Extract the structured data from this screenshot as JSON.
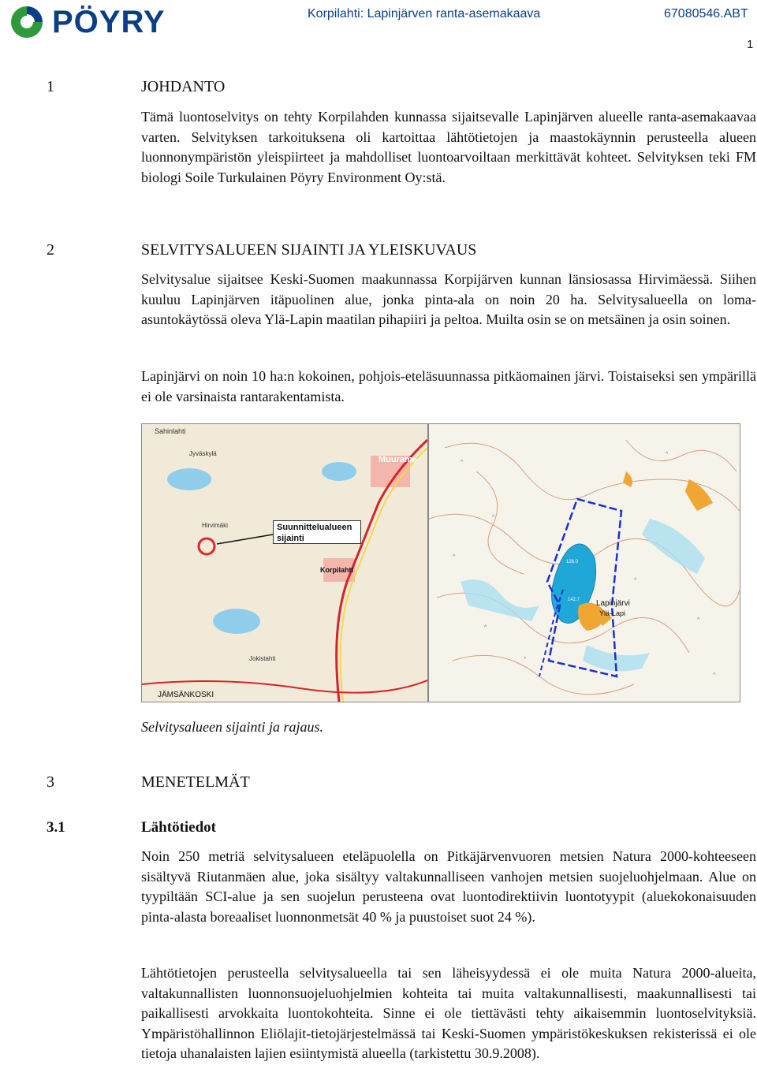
{
  "header": {
    "logo_text": "PÖYRY",
    "doc_title": "Korpilahti: Lapinjärven ranta-asemakaava",
    "doc_code": "67080546.ABT",
    "page_number": "1"
  },
  "sections": {
    "s1": {
      "number": "1",
      "title": "JOHDANTO",
      "p1": "Tämä luontoselvitys on tehty Korpilahden kunnassa sijaitsevalle Lapinjärven alueelle ranta-asemakaavaa varten. Selvityksen tarkoituksena oli kartoittaa lähtötietojen ja maastokäynnin perusteella alueen luonnonympäristön yleispiirteet ja mahdolliset luontoarvoiltaan merkittävät kohteet. Selvityksen teki FM biologi Soile Turkulainen Pöyry Environment Oy:stä."
    },
    "s2": {
      "number": "2",
      "title": "SELVITYSALUEEN SIJAINTI JA YLEISKUVAUS",
      "p1": "Selvitysalue sijaitsee Keski-Suomen maakunnassa Korpijärven kunnan länsiosassa Hirvimäessä. Siihen kuuluu Lapinjärven itäpuolinen alue, jonka pinta-ala on noin 20 ha. Selvitysalueella on loma-asuntokäytössä oleva Ylä-Lapin maatilan pihapiiri ja peltoa. Muilta osin se on metsäinen ja osin soinen.",
      "p2": "Lapinjärvi on noin 10 ha:n kokoinen, pohjois-eteläsuunnassa pitkäomainen järvi. Toistaiseksi sen ympärillä ei ole varsinaista rantarakentamista."
    },
    "figure": {
      "left_map_labels": {
        "callout": "Suunnittelualueen sijainti",
        "place1": "Muurame",
        "place2": "Korpilahti",
        "place3": "JÄMSÄNKOSKI",
        "place4": "Hirvimäki",
        "place5": "Jyväskylä",
        "place6": "Sahinlahti",
        "place7": "Jokistahti"
      },
      "right_map_labels": {
        "lake": "Lapinjärvi",
        "farm": "Ylä-Lapi",
        "elev1": "126.0",
        "elev2": "142.7"
      },
      "caption": "Selvitysalueen sijainti ja rajaus."
    },
    "s3": {
      "number": "3",
      "title": "MENETELMÄT"
    },
    "s31": {
      "number": "3.1",
      "title": "Lähtötiedot",
      "p1": "Noin 250 metriä selvitysalueen eteläpuolella on Pitkäjärvenvuoren metsien Natura 2000-kohteeseen sisältyvä Riutanmäen alue, joka sisältyy valtakunnalliseen vanhojen metsien suojeluohjelmaan. Alue on tyypiltään SCI-alue ja sen suojelun perusteena ovat luontodirektiivin luontotyypit (aluekokonaisuuden pinta-alasta boreaaliset luonnonmetsät 40 % ja puustoiset suot 24 %).",
      "p2": "Lähtötietojen perusteella selvitysalueella tai sen läheisyydessä ei ole muita Natura 2000-alueita, valtakunnallisten luonnonsuojeluohjelmien kohteita tai muita valtakunnallisesti, maakunnallisesti tai paikallisesti arvokkaita luontokohteita. Sinne ei ole tiettävästi tehty aikaisemmin luontoselvityksiä. Ympäristöhallinnon Eliölajit-tietojärjestelmässä tai Keski-Suomen ympäristökeskuksen rekisterissä ei ole tietoja uhanalaisten lajien esiintymistä alueella (tarkistettu 30.9.2008)."
    }
  },
  "colors": {
    "brand_blue": "#0a3f88",
    "brand_green": "#2e9a3a",
    "map_water": "#7fc6e6",
    "map_land": "#f3ede1",
    "marker_red": "#e0262e",
    "boundary_blue": "#1a2fcf",
    "field_orange": "#f0a633"
  }
}
